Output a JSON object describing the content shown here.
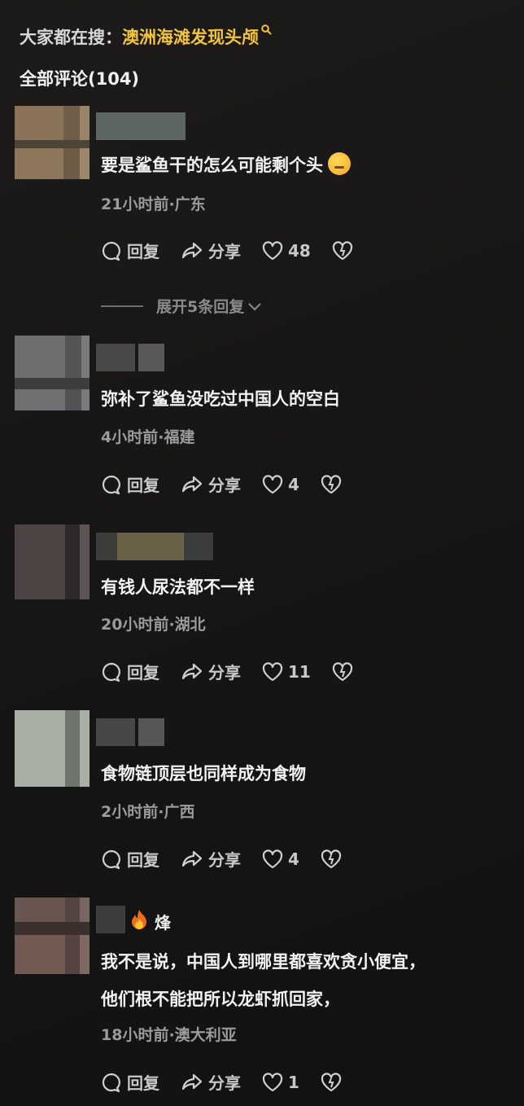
{
  "search": {
    "prefix": "大家都在搜：",
    "term": "澳洲海滩发现头颅"
  },
  "comments_header": "全部评论(104)",
  "comments": [
    {
      "text": "要是鲨鱼干的怎么可能剩个头",
      "meta": "21小时前·广东",
      "reply": "回复",
      "share": "分享",
      "likes": "48",
      "expand": "展开5条回复"
    },
    {
      "text": "弥补了鲨鱼没吃过中国人的空白",
      "meta": "4小时前·福建",
      "reply": "回复",
      "share": "分享",
      "likes": "4"
    },
    {
      "text": "有钱人尿法都不一样",
      "meta": "20小时前·湖北",
      "reply": "回复",
      "share": "分享",
      "likes": "11"
    },
    {
      "text": "食物链顶层也同样成为食物",
      "meta": "2小时前·广西",
      "reply": "回复",
      "share": "分享",
      "likes": "4"
    },
    {
      "badge": "烽",
      "text": "我不是说，中国人到哪里都喜欢贪小便宜，",
      "text2": "他们根不能把所以龙虾抓回家，",
      "meta": "18小时前·澳大利亚",
      "reply": "回复",
      "share": "分享",
      "likes": "1"
    }
  ],
  "colors": {
    "accent": "#f2c43d",
    "background": "#171616",
    "meta": "#9b9b9b"
  },
  "icons": [
    "search-icon",
    "comment-icon",
    "share-icon",
    "heart-icon",
    "broken-heart-icon",
    "chevron-down-icon",
    "fire-icon",
    "thinking-emoji-icon"
  ]
}
